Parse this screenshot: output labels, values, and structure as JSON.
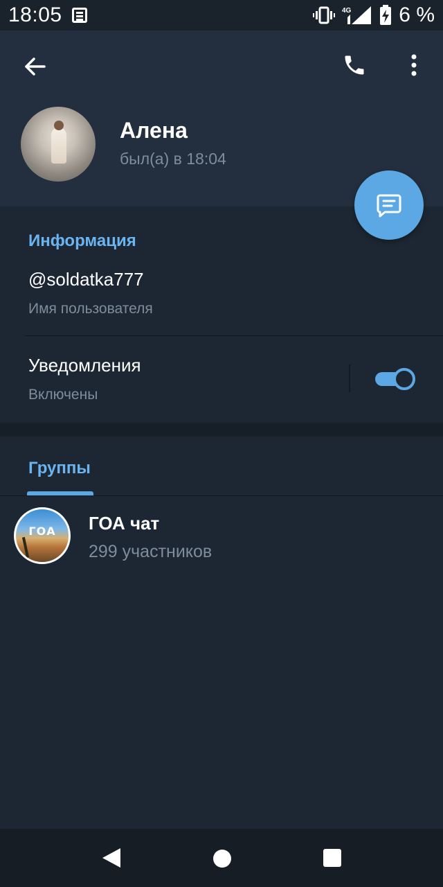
{
  "status_bar": {
    "time": "18:05",
    "network": "4G",
    "battery": "6 %",
    "icons": [
      "notification-icon",
      "vibrate-icon",
      "signal-icon",
      "battery-charging-icon"
    ]
  },
  "header": {
    "icons": [
      "back-arrow-icon",
      "phone-icon",
      "more-vert-icon"
    ]
  },
  "profile": {
    "name": "Алена",
    "status": "был(а) в 18:04"
  },
  "fab": {
    "icon": "message-icon",
    "color": "#5ba8e4"
  },
  "info": {
    "section_title": "Информация",
    "username": "@soldatka777",
    "username_label": "Имя пользователя",
    "notifications_title": "Уведомления",
    "notifications_status": "Включены",
    "notifications_enabled": true
  },
  "groups": {
    "tab_label": "Группы",
    "items": [
      {
        "name": "ГОА чат",
        "members": "299 участников",
        "avatar_text": "ГОА"
      }
    ]
  },
  "nav": {
    "icons": [
      "nav-back-icon",
      "nav-home-icon",
      "nav-recents-icon"
    ]
  },
  "colors": {
    "accent": "#5ba8e4",
    "section_title": "#6bb4f0",
    "background": "#1d2733",
    "header": "#232f3e"
  }
}
